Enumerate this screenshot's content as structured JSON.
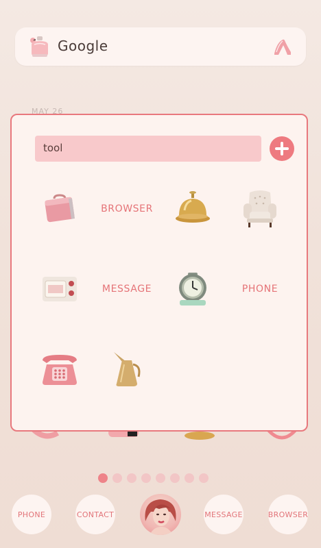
{
  "search_widget": {
    "brand": "Google"
  },
  "date_label": "MAY 26",
  "folder": {
    "search_value": "tool",
    "apps": [
      {
        "type": "icon",
        "icon": "suitcase-icon"
      },
      {
        "type": "label",
        "text": "BROWSER"
      },
      {
        "type": "icon",
        "icon": "service-bell-icon"
      },
      {
        "type": "icon",
        "icon": "armchair-icon"
      },
      {
        "type": "icon",
        "icon": "radio-icon"
      },
      {
        "type": "label",
        "text": "MESSAGE"
      },
      {
        "type": "icon",
        "icon": "alarm-clock-icon"
      },
      {
        "type": "label",
        "text": "PHONE"
      },
      {
        "type": "icon",
        "icon": "telephone-icon"
      },
      {
        "type": "icon",
        "icon": "jug-icon"
      }
    ]
  },
  "page_indicator": {
    "total": 8,
    "current": 1
  },
  "dock": [
    {
      "label": "PHONE"
    },
    {
      "label": "CONTACT"
    },
    {
      "label": ""
    },
    {
      "label": "MESSAGE"
    },
    {
      "label": "BROWSER"
    }
  ],
  "colors": {
    "accent": "#ee7a80",
    "panel_border": "#e8787d",
    "label": "#e57377",
    "search_field": "#f8c9cb"
  }
}
